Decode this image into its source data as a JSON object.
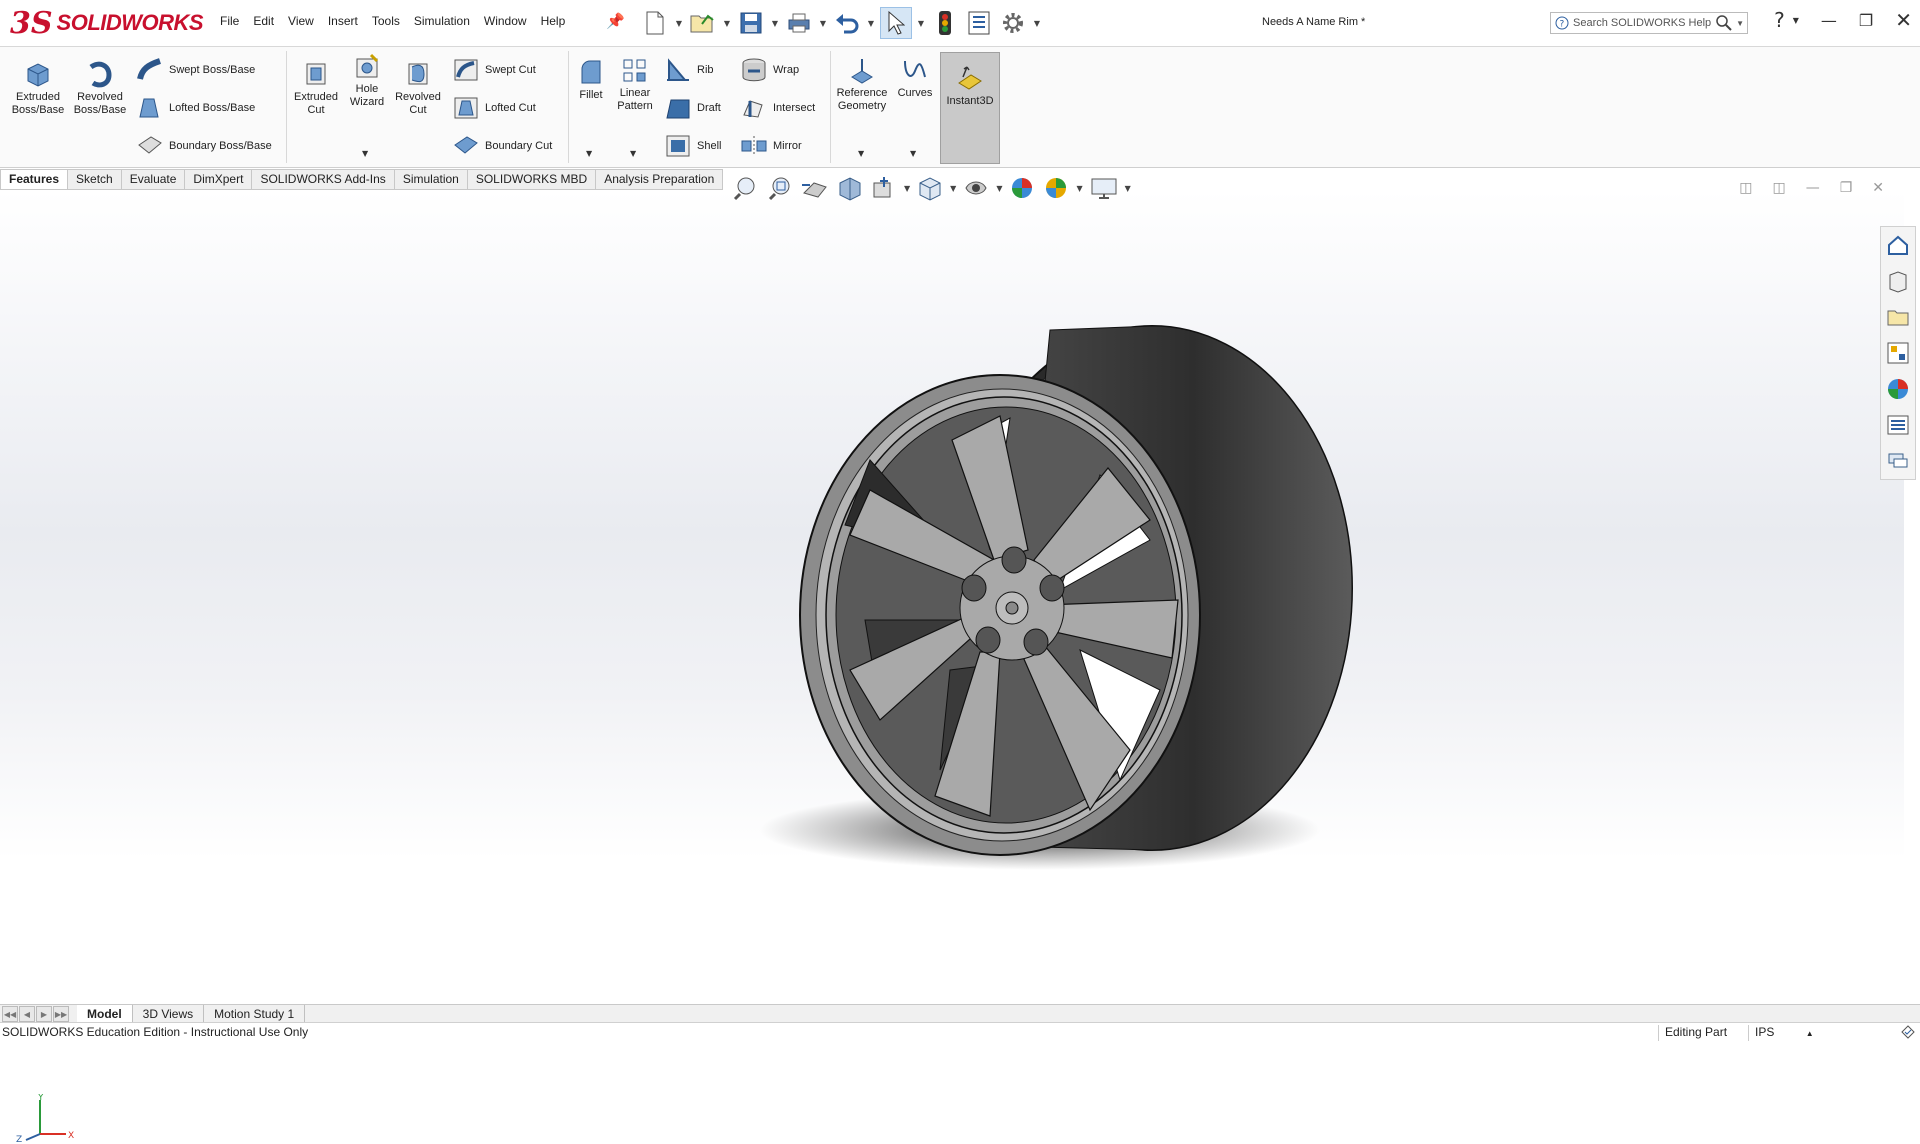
{
  "app": {
    "brand_ds": "3S",
    "brand_name": "SOLIDWORKS"
  },
  "menu": [
    "File",
    "Edit",
    "View",
    "Insert",
    "Tools",
    "Simulation",
    "Window",
    "Help"
  ],
  "document_title": "Needs A Name Rim *",
  "search": {
    "placeholder": "Search SOLIDWORKS Help"
  },
  "ribbon": {
    "extruded_boss": "Extruded\nBoss/Base",
    "revolved_boss": "Revolved\nBoss/Base",
    "swept_boss": "Swept Boss/Base",
    "lofted_boss": "Lofted Boss/Base",
    "boundary_boss": "Boundary Boss/Base",
    "extruded_cut": "Extruded\nCut",
    "hole_wizard": "Hole\nWizard",
    "revolved_cut": "Revolved\nCut",
    "swept_cut": "Swept Cut",
    "lofted_cut": "Lofted Cut",
    "boundary_cut": "Boundary Cut",
    "fillet": "Fillet",
    "linear_pattern": "Linear\nPattern",
    "rib": "Rib",
    "draft": "Draft",
    "shell": "Shell",
    "wrap": "Wrap",
    "intersect": "Intersect",
    "mirror": "Mirror",
    "reference_geometry": "Reference\nGeometry",
    "curves": "Curves",
    "instant3d": "Instant3D"
  },
  "command_tabs": [
    "Features",
    "Sketch",
    "Evaluate",
    "DimXpert",
    "SOLIDWORKS Add-Ins",
    "Simulation",
    "SOLIDWORKS MBD",
    "Analysis Preparation"
  ],
  "bottom_tabs": [
    "Model",
    "3D Views",
    "Motion Study 1"
  ],
  "status": {
    "left": "SOLIDWORKS Education Edition - Instructional Use Only",
    "mode": "Editing Part",
    "units": "IPS"
  },
  "triad": {
    "y": "Y",
    "z": "Z",
    "x": "X"
  },
  "colors": {
    "brand": "#c8102e",
    "rim_face": "#9a9a9a",
    "rim_barrel": "#3c3c3c",
    "instant3d_active": "#c9c9c9"
  }
}
